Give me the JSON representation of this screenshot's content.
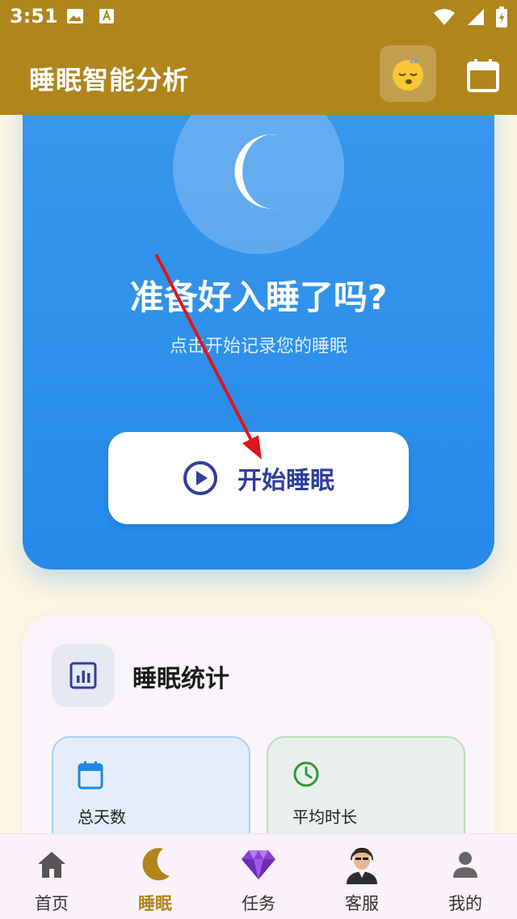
{
  "status_bar": {
    "time": "3:51"
  },
  "app_bar": {
    "title": "睡眠智能分析"
  },
  "sleep_card": {
    "title": "准备好入睡了吗?",
    "subtitle": "点击开始记录您的睡眠",
    "start_button_label": "开始睡眠"
  },
  "stats": {
    "title": "睡眠统计",
    "items": [
      {
        "label": "总天数",
        "icon": "calendar-icon"
      },
      {
        "label": "平均时长",
        "icon": "clock-icon"
      }
    ]
  },
  "bottom_nav": {
    "items": [
      {
        "label": "首页",
        "icon": "home-icon"
      },
      {
        "label": "睡眠",
        "icon": "moon-icon",
        "active": true
      },
      {
        "label": "任务",
        "icon": "gem-icon"
      },
      {
        "label": "客服",
        "icon": "agent-avatar-icon"
      },
      {
        "label": "我的",
        "icon": "person-icon"
      }
    ]
  },
  "colors": {
    "brand": "#b0851c",
    "card_blue": "#258ae8",
    "button_text": "#2f3f9d",
    "background": "#fdf6e3"
  }
}
